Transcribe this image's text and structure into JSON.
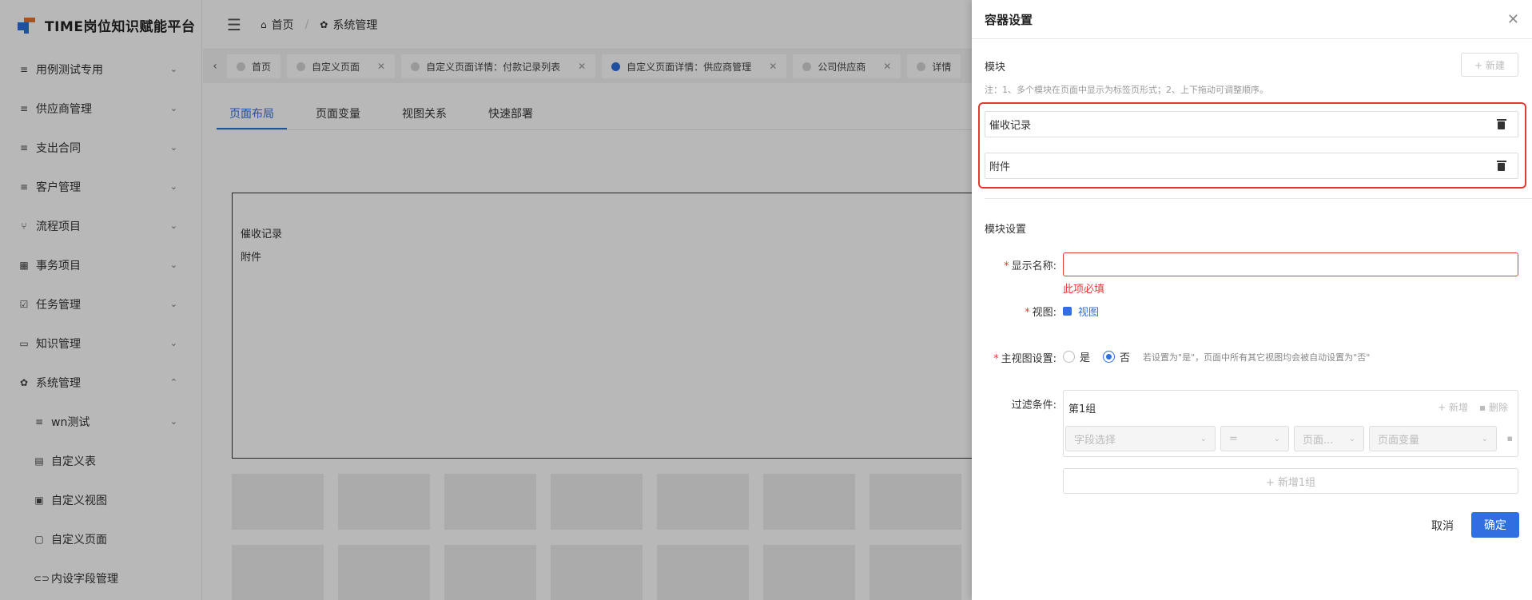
{
  "app": {
    "title": "TIME岗位知识赋能平台"
  },
  "sidebar": {
    "items": [
      {
        "label": "用例测试专用",
        "icon": "list-icon",
        "glyph": "≡",
        "expanded": false
      },
      {
        "label": "供应商管理",
        "icon": "list-icon",
        "glyph": "≡",
        "expanded": false
      },
      {
        "label": "支出合同",
        "icon": "list-icon",
        "glyph": "≡",
        "expanded": false
      },
      {
        "label": "客户管理",
        "icon": "list-icon",
        "glyph": "≡",
        "expanded": false
      },
      {
        "label": "流程项目",
        "icon": "branch-icon",
        "glyph": "⑂",
        "expanded": false
      },
      {
        "label": "事务项目",
        "icon": "grid-icon",
        "glyph": "▦",
        "expanded": false
      },
      {
        "label": "任务管理",
        "icon": "checkbox-icon",
        "glyph": "☑",
        "expanded": false
      },
      {
        "label": "知识管理",
        "icon": "card-icon",
        "glyph": "▭",
        "expanded": false
      },
      {
        "label": "系统管理",
        "icon": "gear-icon",
        "glyph": "✿",
        "expanded": true
      }
    ],
    "sub_items": [
      {
        "label": "wn测试",
        "icon": "filter-icon",
        "glyph": "≡",
        "has_arrow": true
      },
      {
        "label": "自定义表",
        "icon": "table-icon",
        "glyph": "▤",
        "has_arrow": false
      },
      {
        "label": "自定义视图",
        "icon": "view-icon",
        "glyph": "▣",
        "has_arrow": false
      },
      {
        "label": "自定义页面",
        "icon": "page-icon",
        "glyph": "▢",
        "has_arrow": false
      },
      {
        "label": "内设字段管理",
        "icon": "link-icon",
        "glyph": "⊂⊃",
        "has_arrow": false
      }
    ]
  },
  "header": {
    "breadcrumb": [
      {
        "label": "首页",
        "icon": "home-icon"
      },
      {
        "label": "系统管理",
        "icon": "gear-icon"
      }
    ]
  },
  "tabs": [
    {
      "label": "首页",
      "closable": false,
      "active": false
    },
    {
      "label": "自定义页面",
      "closable": true,
      "active": false
    },
    {
      "label": "自定义页面详情：付款记录列表",
      "closable": true,
      "active": false
    },
    {
      "label": "自定义页面详情：供应商管理",
      "closable": true,
      "active": true
    },
    {
      "label": "公司供应商",
      "closable": true,
      "active": false
    },
    {
      "label": "详情",
      "closable": false,
      "active": false
    }
  ],
  "page": {
    "subtabs": [
      "页面布局",
      "页面变量",
      "视图关系",
      "快速部署"
    ],
    "active_subtab": 0,
    "layout_items": [
      "催收记录",
      "附件"
    ]
  },
  "drawer": {
    "title": "容器设置",
    "module_section": "模块",
    "new_label": "+ 新建",
    "note": "注：1、多个模块在页面中显示为标签页形式；2、上下拖动可调整顺序。",
    "modules": [
      "催收记录",
      "附件"
    ],
    "module_settings_title": "模块设置",
    "display_name_label": "显示名称:",
    "display_name_value": "",
    "required_error": "此项必填",
    "view_label": "视图:",
    "view_link": "视图",
    "main_view_label": "主视图设置:",
    "main_view_yes": "是",
    "main_view_no": "否",
    "main_view_value": "否",
    "main_view_hint": "若设置为\"是\"，页面中所有其它视图均会被自动设置为\"否\"",
    "filter_label": "过滤条件:",
    "filter_group": "第1组",
    "filter_add": "+ 新增",
    "filter_delete": "删除",
    "filter_field_placeholder": "字段选择",
    "filter_operator": "=",
    "filter_source": "页面...",
    "filter_variable_placeholder": "页面变量",
    "add_group": "+ 新增1组",
    "cancel": "取消",
    "confirm": "确定"
  },
  "colors": {
    "primary": "#2f6fe0",
    "error": "#e53935",
    "highlight": "#e53935"
  }
}
